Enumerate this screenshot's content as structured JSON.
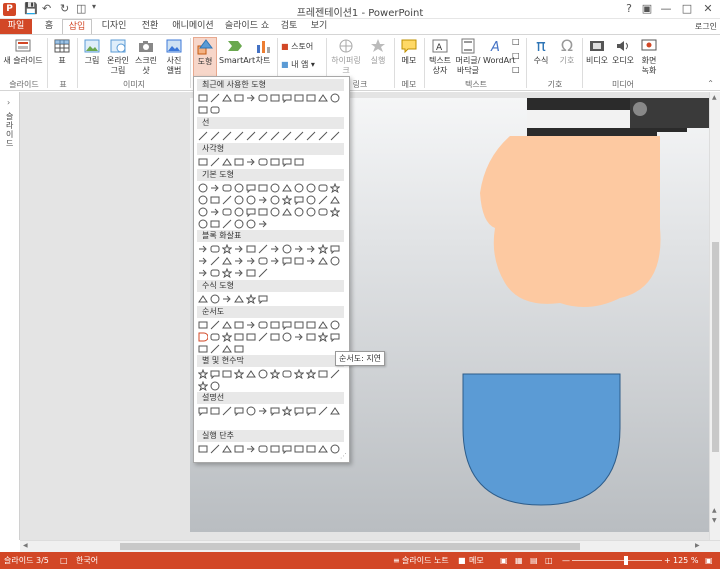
{
  "window": {
    "title": "프레젠테이션1 - PowerPoint",
    "app_icon": "P",
    "login": "로그인"
  },
  "tabs": [
    {
      "label": "파일"
    },
    {
      "label": "홈"
    },
    {
      "label": "삽입"
    },
    {
      "label": "디자인"
    },
    {
      "label": "전환"
    },
    {
      "label": "애니메이션"
    },
    {
      "label": "슬라이드 쇼"
    },
    {
      "label": "검토"
    },
    {
      "label": "보기"
    }
  ],
  "ribbon": {
    "new_slide": "새 슬라이드",
    "table": "표",
    "picture": "그림",
    "online_picture": "온라인 그림",
    "screenshot": "스크린샷",
    "photo_album": "사진 앨범",
    "shapes": "도형",
    "smartart": "SmartArt",
    "chart": "차트",
    "store": "스토어",
    "my_apps": "내 앱",
    "hyperlink": "하이퍼링크",
    "action": "실행",
    "comment": "메모",
    "textbox": "텍스트 상자",
    "header_footer": "머리글/바닥글",
    "wordart": "WordArt",
    "equation": "수식",
    "symbol": "기호",
    "video": "비디오",
    "audio": "오디오",
    "screen_record": "화면 녹화",
    "groups": {
      "slides": "슬라이드",
      "tables": "표",
      "images": "이미지",
      "links": "링크",
      "comments": "메모",
      "text": "텍스트",
      "symbols": "기호",
      "media": "미디어"
    }
  },
  "left_pane": {
    "label": "슬라이드"
  },
  "shapes_menu": {
    "categories": [
      {
        "label": "최근에 사용한 도형"
      },
      {
        "label": "선"
      },
      {
        "label": "사각형"
      },
      {
        "label": "기본 도형"
      },
      {
        "label": "블록 화살표"
      },
      {
        "label": "수식 도형"
      },
      {
        "label": "순서도"
      },
      {
        "label": "별 및 현수막"
      },
      {
        "label": "설명선"
      },
      {
        "label": "실행 단추"
      }
    ],
    "tooltip": "순서도: 지연"
  },
  "status": {
    "slide_info": "슬라이드 3/5",
    "language": "한국어",
    "notes": "슬라이드 노트",
    "comments": "메모",
    "zoom": "125 %"
  },
  "colors": {
    "accent": "#d24726",
    "hand_skin": "#fdc9a1",
    "pocket": "#5b9bd5",
    "sleeve": "#2b2b2b"
  }
}
